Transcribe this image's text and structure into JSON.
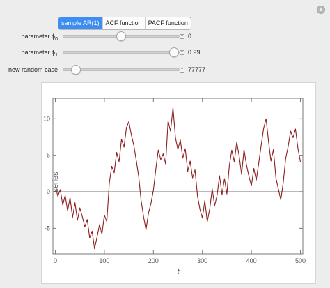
{
  "tabs": [
    {
      "label": "sample AR(1)",
      "active": true
    },
    {
      "label": "ACF function",
      "active": false
    },
    {
      "label": "PACF function",
      "active": false
    }
  ],
  "controls": {
    "phi0": {
      "label": "parameter ϕ",
      "sub": "0",
      "value": "0",
      "level": 0.5
    },
    "phi1": {
      "label": "parameter ϕ",
      "sub": "1",
      "value": "0.99",
      "level": 0.995
    },
    "random": {
      "label": "new random case",
      "value": "77777",
      "level": 0.08
    }
  },
  "icons": {
    "settings": "gear-icon",
    "increment": "plus-icon"
  },
  "colors": {
    "accent": "#3e8df0",
    "series": "#8c1f1f"
  },
  "chart_data": {
    "type": "line",
    "xlabel": "t",
    "ylabel": "series",
    "xlim": [
      -5,
      505
    ],
    "ylim": [
      -8.5,
      12.8
    ],
    "xticks": [
      0,
      100,
      200,
      300,
      400,
      500
    ],
    "yticks": [
      -5,
      0,
      5,
      10
    ],
    "reference_line": 0,
    "grid": false,
    "series": [
      {
        "x": [
          0,
          5,
          10,
          15,
          20,
          25,
          30,
          35,
          40,
          45,
          50,
          55,
          60,
          65,
          70,
          75,
          80,
          85,
          90,
          95,
          100,
          105,
          110,
          115,
          120,
          125,
          130,
          135,
          140,
          145,
          150,
          155,
          160,
          165,
          170,
          175,
          180,
          185,
          190,
          195,
          200,
          205,
          210,
          215,
          220,
          225,
          230,
          235,
          240,
          245,
          250,
          255,
          260,
          265,
          270,
          275,
          280,
          285,
          290,
          295,
          300,
          305,
          310,
          315,
          320,
          325,
          330,
          335,
          340,
          345,
          350,
          355,
          360,
          365,
          370,
          375,
          380,
          385,
          390,
          395,
          400,
          405,
          410,
          415,
          420,
          425,
          430,
          435,
          440,
          445,
          450,
          455,
          460,
          465,
          470,
          475,
          480,
          485,
          490,
          495,
          500
        ],
        "y": [
          0.8,
          -0.6,
          0.3,
          -1.8,
          -0.5,
          -2.6,
          -0.8,
          -3.5,
          -1.5,
          -3.9,
          -2.2,
          -3.4,
          -4.8,
          -3.8,
          -6.3,
          -5.4,
          -7.8,
          -6.2,
          -4.5,
          -5.8,
          -3.2,
          -4.1,
          1.2,
          3.5,
          2.6,
          5.4,
          4.1,
          7.2,
          6.1,
          8.8,
          9.6,
          7.8,
          6.4,
          4.3,
          2.1,
          -1.2,
          -3.4,
          -5.2,
          -2.9,
          -1.6,
          0.2,
          3.1,
          5.7,
          4.4,
          5.2,
          3.8,
          9.7,
          8.3,
          11.5,
          7.4,
          5.8,
          7.1,
          4.6,
          5.9,
          2.8,
          4.2,
          1.9,
          3.0,
          -0.6,
          -2.4,
          -3.6,
          -1.2,
          -4.1,
          -2.3,
          0.4,
          -1.9,
          -0.5,
          2.2,
          -0.4,
          1.8,
          -0.3,
          3.6,
          5.7,
          4.1,
          6.8,
          4.9,
          2.4,
          5.8,
          3.7,
          2.1,
          0.8,
          3.2,
          1.6,
          3.9,
          6.4,
          8.7,
          10.0,
          6.9,
          4.2,
          5.8,
          1.9,
          0.4,
          -1.1,
          1.2,
          4.6,
          6.2,
          8.3,
          7.4,
          8.6,
          5.9,
          4.1
        ]
      }
    ]
  }
}
